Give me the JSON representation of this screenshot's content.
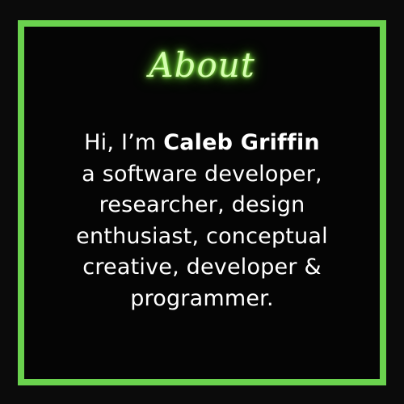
{
  "heading": "About",
  "bio": {
    "greeting": "Hi, I’m",
    "name": "Caleb Griffin",
    "lines": [
      "a software developer,",
      "researcher, design",
      "enthusiast, conceptual",
      "creative, developer &",
      "programmer."
    ]
  },
  "colors": {
    "frame": "#6ad24e",
    "background": "#050505",
    "heading_glow": "#9bff4f",
    "text": "#ffffff"
  }
}
